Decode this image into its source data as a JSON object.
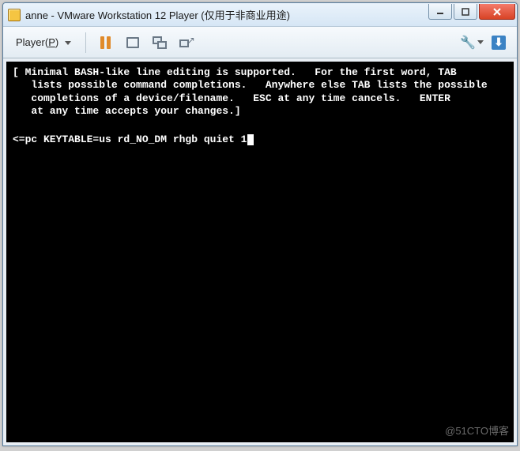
{
  "titlebar": {
    "title": "anne - VMware Workstation 12 Player (仅用于非商业用途)"
  },
  "toolbar": {
    "player_menu_label": "Player(P)"
  },
  "terminal": {
    "help_text": "[ Minimal BASH-like line editing is supported.   For the first word, TAB\n   lists possible command completions.   Anywhere else TAB lists the possible\n   completions of a device/filename.   ESC at any time cancels.   ENTER\n   at any time accepts your changes.]",
    "command_line": "<=pc KEYTABLE=us rd_NO_DM rhgb quiet 1"
  },
  "watermark": "@51CTO博客"
}
